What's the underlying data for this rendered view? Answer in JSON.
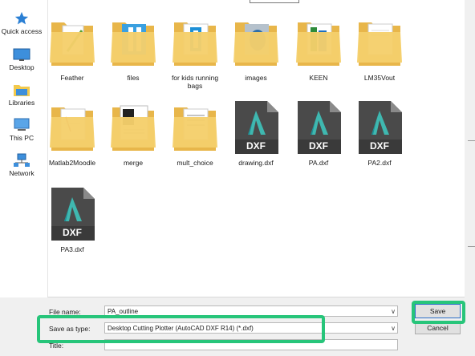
{
  "sidebar": {
    "items": [
      {
        "label": "Quick access",
        "icon": "star-icon"
      },
      {
        "label": "Desktop",
        "icon": "desktop-icon"
      },
      {
        "label": "Libraries",
        "icon": "libraries-icon"
      },
      {
        "label": "This PC",
        "icon": "computer-icon"
      },
      {
        "label": "Network",
        "icon": "network-icon"
      }
    ]
  },
  "files": [
    {
      "name": "Feather",
      "type": "folder"
    },
    {
      "name": "files",
      "type": "folder"
    },
    {
      "name": "for kids running bags",
      "type": "folder"
    },
    {
      "name": "images",
      "type": "folder"
    },
    {
      "name": "KEEN",
      "type": "folder"
    },
    {
      "name": "LM35Vout",
      "type": "folder"
    },
    {
      "name": "Matlab2Moodle",
      "type": "folder"
    },
    {
      "name": "merge",
      "type": "folder"
    },
    {
      "name": "mult_choice",
      "type": "folder"
    },
    {
      "name": "drawing.dxf",
      "type": "dxf"
    },
    {
      "name": "PA.dxf",
      "type": "dxf"
    },
    {
      "name": "PA2.dxf",
      "type": "dxf"
    },
    {
      "name": "PA3.dxf",
      "type": "dxf"
    }
  ],
  "dxf_badge": "DXF",
  "form": {
    "file_name_label": "File name:",
    "file_name_value": "PA_outline",
    "save_as_type_label": "Save as type:",
    "save_as_type_value": "Desktop Cutting Plotter (AutoCAD DXF R14) (*.dxf)",
    "title_label": "Title:"
  },
  "buttons": {
    "save": "Save",
    "cancel": "Cancel"
  },
  "colors": {
    "highlight": "#27c57a",
    "folder": "#f5cf6b",
    "dxf_body": "#4a4a4a"
  }
}
